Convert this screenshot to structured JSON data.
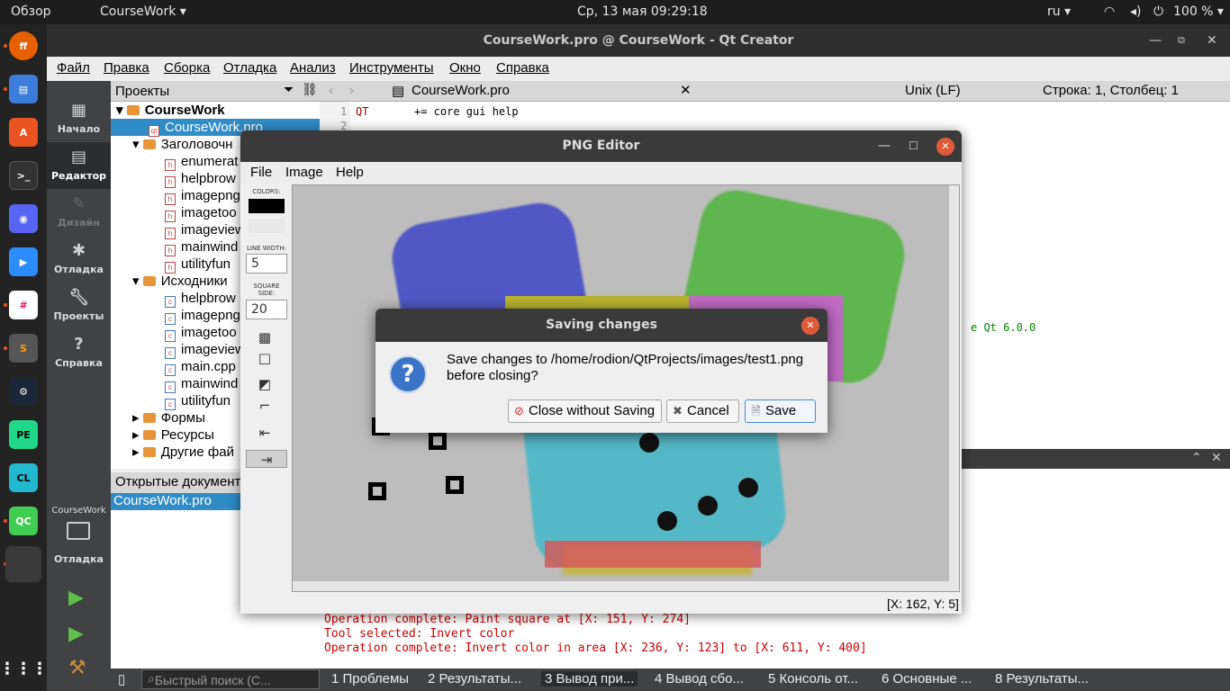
{
  "topbar": {
    "overview": "Обзор",
    "app_menu": "CourseWork ▾",
    "clock": "Ср, 13 мая  09:29:18",
    "lang": "ru ▾",
    "battery": "100 % ▾"
  },
  "window": {
    "title": "CourseWork.pro @ CourseWork - Qt Creator"
  },
  "menu": {
    "file": "Файл",
    "edit": "Правка",
    "build": "Сборка",
    "debug": "Отладка",
    "analyze": "Анализ",
    "tools": "Инструменты",
    "window": "Окно",
    "help": "Справка"
  },
  "modes": {
    "welcome": "Начало",
    "edit": "Редактор",
    "design": "Дизайн",
    "debug": "Отладка",
    "projects": "Проекты",
    "help": "Справка",
    "kit_project": "CourseWork",
    "kit_mode": "Отладка"
  },
  "projects": {
    "header": "Проекты",
    "root": "CourseWork",
    "pro_file": "CourseWork.pro",
    "headers_folder": "Заголовочн",
    "headers": [
      "enumerat",
      "helpbrow",
      "imagepng",
      "imagetoo",
      "imageview",
      "mainwind",
      "utilityfun"
    ],
    "sources_folder": "Исходники",
    "sources": [
      "helpbrow",
      "imagepng",
      "imagetoo",
      "imageview",
      "main.cpp",
      "mainwind",
      "utilityfun"
    ],
    "forms": "Формы",
    "resources": "Ресурсы",
    "other": "Другие фай"
  },
  "open_docs": {
    "header": "Открытые документ",
    "item": "CourseWork.pro"
  },
  "editor": {
    "tab": "CourseWork.pro",
    "line_endings": "Unix (LF)",
    "cursor_pos": "Строка: 1, Столбец: 1",
    "line1_no": "1",
    "line1_kw": "QT",
    "line1_rest": "+= core gui help",
    "line2_no": "2",
    "comment_fragment": "e Qt 6.0.0"
  },
  "output": {
    "lines": [
      "Operation complete: Paint square at [X: 151, Y: 274]",
      "Tool selected: Invert color",
      "Operation complete: Invert color in area [X: 236, Y: 123] to [X: 611, Y: 400]"
    ]
  },
  "statusbar": {
    "search_placeholder": "Быстрый поиск (C...",
    "panes": [
      "1  Проблемы",
      "2  Результаты...",
      "3  Вывод при...",
      "4  Вывод сбо...",
      "5  Консоль от...",
      "6  Основные ...",
      "8  Результаты..."
    ]
  },
  "png_editor": {
    "title": "PNG Editor",
    "menu": {
      "file": "File",
      "image": "Image",
      "help": "Help"
    },
    "colors_label": "COLORS:",
    "line_width_label": "LINE WIDTH:",
    "line_width": "5",
    "square_side_label": "SQUARE SIDE:",
    "square_side": "20",
    "status_coords": "[X: 162, Y: 5]"
  },
  "dialog": {
    "title": "Saving changes",
    "message_line1": "Save changes to /home/rodion/QtProjects/images/test1.png",
    "message_line2": "before closing?",
    "close_without_saving": "Close without Saving",
    "cancel": "Cancel",
    "save": "Save"
  }
}
